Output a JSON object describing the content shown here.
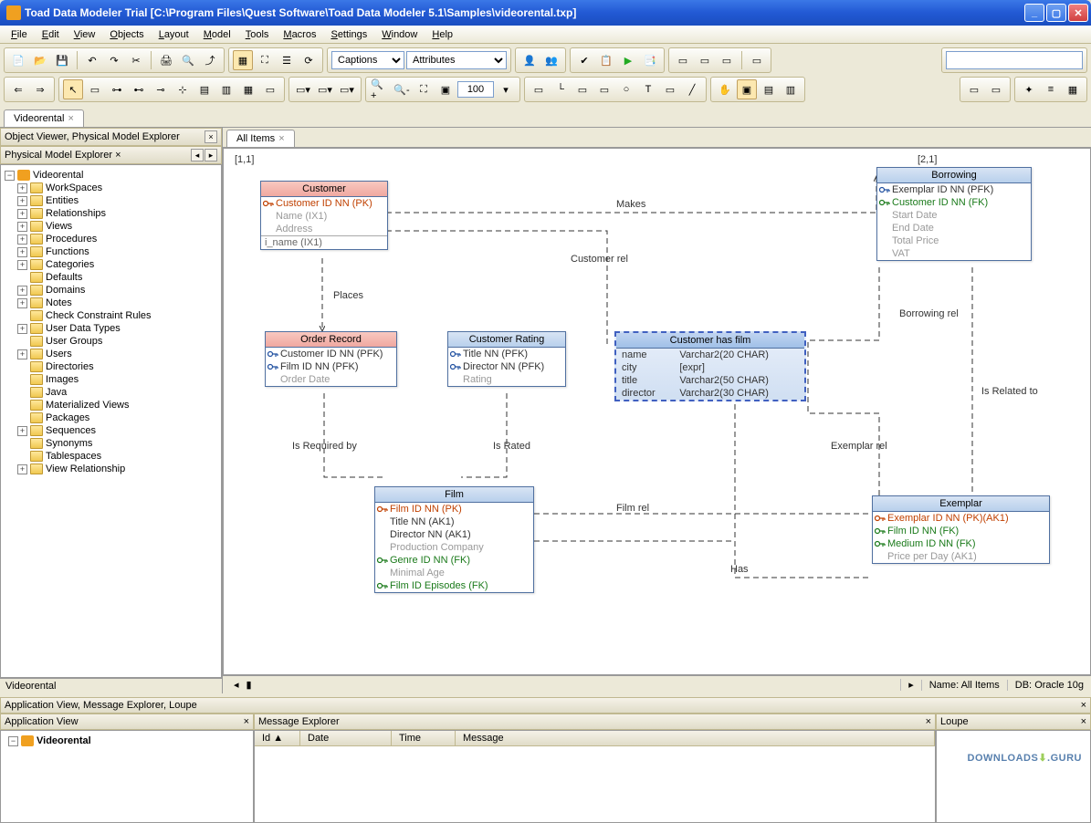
{
  "window": {
    "title": "Toad Data Modeler Trial [C:\\Program Files\\Quest Software\\Toad Data Modeler 5.1\\Samples\\videorental.txp]"
  },
  "menu": [
    "File",
    "Edit",
    "View",
    "Objects",
    "Layout",
    "Model",
    "Tools",
    "Macros",
    "Settings",
    "Window",
    "Help"
  ],
  "toolbar": {
    "combo1": "Captions",
    "combo2": "Attributes",
    "zoom": "100"
  },
  "doc_tab": {
    "label": "Videorental"
  },
  "left": {
    "header1": "Object Viewer, Physical Model Explorer",
    "header2": "Physical Model Explorer",
    "root": "Videorental",
    "items": [
      {
        "label": "WorkSpaces",
        "exp": "+"
      },
      {
        "label": "Entities",
        "exp": "+"
      },
      {
        "label": "Relationships",
        "exp": "+"
      },
      {
        "label": "Views",
        "exp": "+"
      },
      {
        "label": "Procedures",
        "exp": "+"
      },
      {
        "label": "Functions",
        "exp": "+"
      },
      {
        "label": "Categories",
        "exp": "+"
      },
      {
        "label": "Defaults",
        "exp": ""
      },
      {
        "label": "Domains",
        "exp": "+"
      },
      {
        "label": "Notes",
        "exp": "+"
      },
      {
        "label": "Check Constraint Rules",
        "exp": ""
      },
      {
        "label": "User Data Types",
        "exp": "+"
      },
      {
        "label": "User Groups",
        "exp": ""
      },
      {
        "label": "Users",
        "exp": "+"
      },
      {
        "label": "Directories",
        "exp": ""
      },
      {
        "label": "Images",
        "exp": ""
      },
      {
        "label": "Java",
        "exp": ""
      },
      {
        "label": "Materialized Views",
        "exp": ""
      },
      {
        "label": "Packages",
        "exp": ""
      },
      {
        "label": "Sequences",
        "exp": "+"
      },
      {
        "label": "Synonyms",
        "exp": ""
      },
      {
        "label": "Tablespaces",
        "exp": ""
      },
      {
        "label": "View Relationship",
        "exp": "+"
      }
    ],
    "footer": "Videorental"
  },
  "canvas": {
    "tab": "All Items",
    "coord1": "[1,1]",
    "coord2": "[2,1]",
    "status_name_label": "Name:",
    "status_name": "All Items",
    "status_db_label": "DB:",
    "status_db": "Oracle 10g",
    "entities": {
      "customer": {
        "title": "Customer",
        "rows": [
          {
            "t": "Customer ID NN  (PK)",
            "cls": "pk",
            "k": "pk"
          },
          {
            "t": "Name  (IX1)",
            "cls": "dim"
          },
          {
            "t": "Address",
            "cls": "dim"
          }
        ],
        "foot": "i_name (IX1)"
      },
      "order": {
        "title": "Order Record",
        "rows": [
          {
            "t": "Customer ID NN  (PFK)",
            "cls": "normal",
            "k": "pfk"
          },
          {
            "t": "Film ID NN  (PFK)",
            "cls": "normal",
            "k": "pfk"
          },
          {
            "t": "Order Date",
            "cls": "dim"
          }
        ]
      },
      "rating": {
        "title": "Customer Rating",
        "rows": [
          {
            "t": "Title NN  (PFK)",
            "cls": "normal",
            "k": "pfk"
          },
          {
            "t": "Director NN  (PFK)",
            "cls": "normal",
            "k": "pfk"
          },
          {
            "t": "Rating",
            "cls": "dim"
          }
        ]
      },
      "film": {
        "title": "Film",
        "rows": [
          {
            "t": "Film ID NN  (PK)",
            "cls": "pk",
            "k": "pk"
          },
          {
            "t": "Title NN (AK1)",
            "cls": "normal"
          },
          {
            "t": "Director NN (AK1)",
            "cls": "normal"
          },
          {
            "t": "Production Company",
            "cls": "dim"
          },
          {
            "t": "Genre ID NN  (FK)",
            "cls": "fk",
            "k": "fk"
          },
          {
            "t": "Minimal Age",
            "cls": "dim"
          },
          {
            "t": "Film ID Episodes  (FK)",
            "cls": "fk",
            "k": "fk"
          }
        ]
      },
      "borrowing": {
        "title": "Borrowing",
        "rows": [
          {
            "t": "Exemplar ID NN  (PFK)",
            "cls": "normal",
            "k": "pfk"
          },
          {
            "t": "Customer ID NN  (FK)",
            "cls": "fk",
            "k": "fk"
          },
          {
            "t": "Start Date",
            "cls": "dim"
          },
          {
            "t": "End Date",
            "cls": "dim"
          },
          {
            "t": "Total Price",
            "cls": "dim"
          },
          {
            "t": "VAT",
            "cls": "dim"
          }
        ]
      },
      "exemplar": {
        "title": "Exemplar",
        "rows": [
          {
            "t": "Exemplar ID NN  (PK)(AK1)",
            "cls": "pk",
            "k": "pk"
          },
          {
            "t": "Film ID NN  (FK)",
            "cls": "fk",
            "k": "fk"
          },
          {
            "t": "Medium ID NN  (FK)",
            "cls": "fk",
            "k": "fk"
          },
          {
            "t": "Price per Day  (AK1)",
            "cls": "dim"
          }
        ]
      }
    },
    "view": {
      "title": "Customer has film",
      "rows": [
        [
          "name",
          "Varchar2(20 CHAR)"
        ],
        [
          "city",
          "[expr]"
        ],
        [
          "title",
          "Varchar2(50 CHAR)"
        ],
        [
          "director",
          "Varchar2(30 CHAR)"
        ]
      ]
    },
    "labels": {
      "makes": "Makes",
      "custrel": "Customer rel",
      "places": "Places",
      "isreq": "Is Required by",
      "israted": "Is Rated",
      "filmrel": "Film rel",
      "has": "Has",
      "borrel": "Borrowing rel",
      "isrel": "Is Related to",
      "exrel": "Exemplar rel"
    }
  },
  "bottom": {
    "strip": "Application View, Message Explorer, Loupe",
    "appview_title": "Application View",
    "appview_item": "Videorental",
    "msg_title": "Message Explorer",
    "msg_cols": [
      "Id",
      "Date",
      "Time",
      "Message"
    ],
    "loupe_title": "Loupe"
  },
  "watermark": {
    "a": "DOWNLOADS",
    "b": ".GURU"
  }
}
